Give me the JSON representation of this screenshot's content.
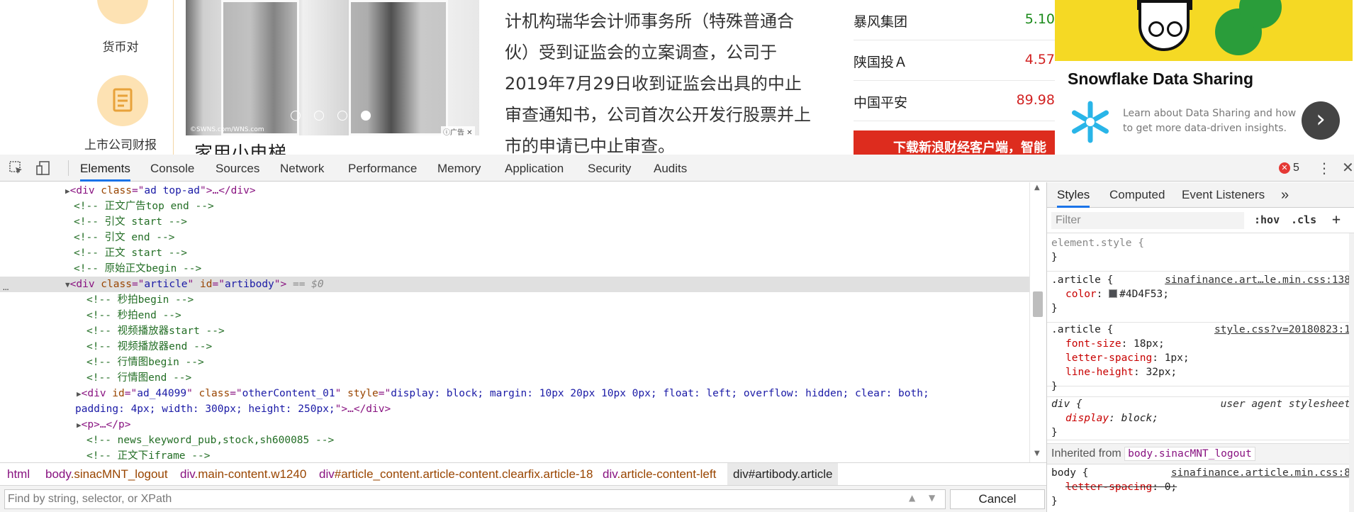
{
  "website": {
    "left_nav": [
      {
        "label": "货币对",
        "icon": "location-pin-icon"
      },
      {
        "label": "上市公司财报",
        "icon": "document-icon"
      }
    ],
    "photo": {
      "caption": "家用小电梯",
      "watermark": "©SWNS.com/WNS.com",
      "ad_tag": "广告",
      "slide_count": 4,
      "active_slide": 4
    },
    "article_text": "计机构瑞华会计师事务所（特殊普通合伙）受到证监会的立案调查，公司于2019年7月29日收到证监会出具的中止审查通知书，公司首次公开发行股票并上市的申请已中止审查。",
    "quotes": [
      {
        "name": "暴风集团",
        "value": "5.10",
        "color": "#1a8a1a"
      },
      {
        "name": "陕国投Ａ",
        "value": "4.57",
        "color": "#d22222"
      },
      {
        "name": "中国平安",
        "value": "89.98",
        "color": "#d22222"
      }
    ],
    "red_banner": "下载新浪财经客户端，智能",
    "ad": {
      "title": "Snowflake Data Sharing",
      "text": "Learn about Data Sharing and how to get more data-driven insights.",
      "next_icon": "chevron-right-icon"
    }
  },
  "devtools": {
    "tabs": [
      "Elements",
      "Console",
      "Sources",
      "Network",
      "Performance",
      "Memory",
      "Application",
      "Security",
      "Audits"
    ],
    "active_tab": "Elements",
    "error_count": "5",
    "dom_lines": {
      "l1_tag": "div",
      "l1_cls_name": "class",
      "l1_cls_val": "ad top-ad",
      "l1_tail": ">…</div>",
      "c1": "<!-- 正文广告top end -->",
      "c2": "<!-- 引文 start -->",
      "c3": "<!-- 引文 end -->",
      "c4": "<!-- 正文 start -->",
      "c5": "<!-- 原始正文begin -->",
      "sel_tag": "div",
      "sel_a1": "class",
      "sel_v1": "article",
      "sel_a2": "id",
      "sel_v2": "artibody",
      "sel_eq": "== $0",
      "c6": "<!-- 秒拍begin -->",
      "c7": "<!-- 秒拍end -->",
      "c8": "<!-- 视频播放器start -->",
      "c9": "<!-- 视频播放器end -->",
      "c10": "<!-- 行情图begin -->",
      "c11": "<!-- 行情图end -->",
      "ad_tag": "div",
      "ad_a1": "id",
      "ad_v1": "ad_44099",
      "ad_a2": "class",
      "ad_v2": "otherContent_01",
      "ad_a3": "style",
      "ad_v3a": "display: block; margin: 10px 20px 10px 0px; float: left; overflow: hidden; clear: both;",
      "ad_v3b": "padding: 4px; width: 300px; height: 250px;",
      "ad_tail": ">…</div>",
      "p_line": "<p>…</p>",
      "c12": "<!-- news_keyword_pub,stock,sh600085 -->",
      "c13": "<!-- 正文下iframe -->"
    },
    "breadcrumbs": [
      {
        "tag": "html",
        "cls": ""
      },
      {
        "tag": "body",
        "cls": ".sinacMNT_logout"
      },
      {
        "tag": "div",
        "cls": ".main-content.w1240"
      },
      {
        "tag": "div",
        "cls": "#article_content.article-content.clearfix.article-18"
      },
      {
        "tag": "div",
        "cls": ".article-content-left"
      },
      {
        "tag": "div",
        "cls": "#artibody.article"
      }
    ],
    "find_placeholder": "Find by string, selector, or XPath",
    "cancel_label": "Cancel",
    "styles": {
      "tabs": [
        "Styles",
        "Computed",
        "Event Listeners"
      ],
      "more_tabs": "»",
      "filter_placeholder": "Filter",
      "hov": ":hov",
      "cls": ".cls",
      "add": "+",
      "element_style": "element.style {",
      "close": "}",
      "rule1_sel": ".article {",
      "rule1_src": "sinafinance.art…le.min.css:138",
      "rule1_prop": "color",
      "rule1_val": "#4D4F53;",
      "rule1_swatch": "#4D4F53",
      "rule2_sel": ".article {",
      "rule2_src": "style.css?v=20180823:1",
      "rule2_p1": "font-size",
      "rule2_v1": "18px;",
      "rule2_p2": "letter-spacing",
      "rule2_v2": "1px;",
      "rule2_p3": "line-height",
      "rule2_v3": "32px;",
      "rule3_sel": "div {",
      "rule3_src": "user agent stylesheet",
      "rule3_prop": "display",
      "rule3_val": "block;",
      "inherited_label": "Inherited from",
      "inherited_tag": "body.sinacMNT_logout",
      "rule4_sel": "body {",
      "rule4_src": "sinafinance.article.min.css:8",
      "rule4_prop": "letter-spacing",
      "rule4_val": "0;"
    }
  }
}
